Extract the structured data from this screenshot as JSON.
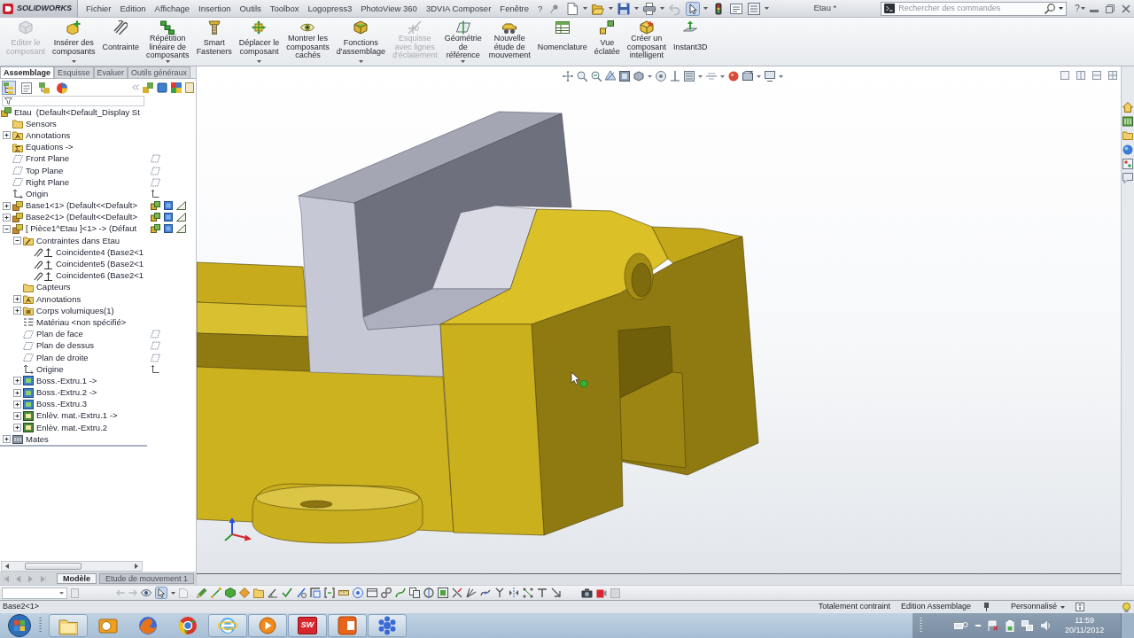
{
  "title_bar": {
    "logo": "SOLIDWORKS",
    "menu": [
      "Fichier",
      "Edition",
      "Affichage",
      "Insertion",
      "Outils",
      "Toolbox",
      "Logopress3",
      "PhotoView 360",
      "3DVIA Composer",
      "Fenêtre",
      "?"
    ],
    "quick_access": [
      {
        "kind": "new",
        "menu": true,
        "pressed": false
      },
      {
        "kind": "open",
        "menu": true,
        "pressed": false
      },
      {
        "kind": "save",
        "menu": true,
        "pressed": false
      },
      {
        "kind": "print",
        "menu": true,
        "pressed": false
      },
      {
        "kind": "undo",
        "menu": false,
        "pressed": false
      },
      {
        "kind": "select",
        "menu": true,
        "pressed": true
      },
      {
        "kind": "rebuild",
        "menu": false,
        "pressed": false
      },
      {
        "kind": "properties",
        "menu": false,
        "pressed": false
      },
      {
        "kind": "options",
        "menu": true,
        "pressed": false
      }
    ],
    "document_title": "Etau *",
    "search": {
      "placeholder": "Rechercher des commandes"
    },
    "help": "?"
  },
  "command_manager": {
    "buttons": [
      {
        "kind": "edit",
        "label": "Editer le\ncomposant",
        "disabled": true,
        "menu": false
      },
      {
        "kind": "insert",
        "label": "Insérer des\ncomposants",
        "disabled": false,
        "menu": true
      },
      {
        "kind": "mate",
        "label": "Contrainte",
        "disabled": false,
        "menu": false
      },
      {
        "kind": "pattern",
        "label": "Répétition\nlinéaire de\ncomposants",
        "disabled": false,
        "menu": true
      },
      {
        "kind": "fastener",
        "label": "Smart\nFasteners",
        "disabled": false,
        "menu": false
      },
      {
        "kind": "move",
        "label": "Déplacer le\ncomposant",
        "disabled": false,
        "menu": true
      },
      {
        "kind": "show",
        "label": "Montrer les\ncomposants\ncachés",
        "disabled": false,
        "menu": false
      },
      {
        "kind": "feature",
        "label": "Fonctions\nd'assemblage",
        "disabled": false,
        "menu": true
      },
      {
        "kind": "sketch",
        "label": "Esquisse\navec lignes\nd'éclatement",
        "disabled": true,
        "menu": false
      },
      {
        "kind": "geometry",
        "label": "Géométrie\nde\nréférence",
        "disabled": false,
        "menu": true
      },
      {
        "kind": "motion",
        "label": "Nouvelle\nétude de\nmouvement",
        "disabled": false,
        "menu": false
      },
      {
        "kind": "bom",
        "label": "Nomenclature",
        "disabled": false,
        "menu": false
      },
      {
        "kind": "explode",
        "label": "Vue\néclatée",
        "disabled": false,
        "menu": false
      },
      {
        "kind": "smart",
        "label": "Créer un\ncomposant\nintelligent",
        "disabled": false,
        "menu": false
      },
      {
        "kind": "instant3d",
        "label": "Instant3D",
        "disabled": false,
        "menu": false
      }
    ],
    "tabs": [
      {
        "label": "Assemblage",
        "selected": true
      },
      {
        "label": "Esquisse",
        "selected": false
      },
      {
        "label": "Evaluer",
        "selected": false
      },
      {
        "label": "Outils généraux",
        "selected": false
      }
    ]
  },
  "feature_tree": {
    "panel_tabs": [
      {
        "kind": "tree",
        "selected": true
      },
      {
        "kind": "properties",
        "selected": false
      },
      {
        "kind": "configurations",
        "selected": false
      },
      {
        "kind": "display",
        "selected": false
      }
    ],
    "items": [
      {
        "label": "Etau  (Default<Default_Display St",
        "kind": "assembly",
        "children": [
          {
            "label": "Sensors",
            "kind": "folder"
          },
          {
            "label": "Annotations",
            "kind": "annotations",
            "expanded": false
          },
          {
            "label": "Equations ->",
            "kind": "equations"
          },
          {
            "label": "Front Plane",
            "kind": "plane"
          },
          {
            "label": "Top Plane",
            "kind": "plane"
          },
          {
            "label": "Right Plane",
            "kind": "plane"
          },
          {
            "label": "Origin",
            "kind": "origin"
          },
          {
            "label": "Base1<1> (Default<<Default>",
            "kind": "part",
            "expanded": false
          },
          {
            "label": "Base2<1> (Default<<Default>",
            "kind": "part",
            "expanded": false
          },
          {
            "label": "[ Pièce1^Etau ]<1> -> (Défaut",
            "kind": "part",
            "expanded": true,
            "children": [
              {
                "label": "Contraintes dans Etau",
                "kind": "mate_folder",
                "expanded": true,
                "children": [
                  {
                    "label": "Coincidente4 (Base2<1",
                    "kind": "mate"
                  },
                  {
                    "label": "Coincidente5 (Base2<1",
                    "kind": "mate"
                  },
                  {
                    "label": "Coincidente6 (Base2<1",
                    "kind": "mate"
                  }
                ]
              },
              {
                "label": "Capteurs",
                "kind": "folder"
              },
              {
                "label": "Annotations",
                "kind": "annotations",
                "expanded": false
              },
              {
                "label": "Corps volumiques(1)",
                "kind": "bodies",
                "expanded": false
              },
              {
                "label": "Matériau <non spécifié>",
                "kind": "material"
              },
              {
                "label": "Plan de face",
                "kind": "plane"
              },
              {
                "label": "Plan de dessus",
                "kind": "plane"
              },
              {
                "label": "Plan de droite",
                "kind": "plane"
              },
              {
                "label": "Origine",
                "kind": "origin"
              },
              {
                "label": "Boss.-Extru.1 ->",
                "kind": "boss",
                "expanded": false
              },
              {
                "label": "Boss.-Extru.2 ->",
                "kind": "boss",
                "expanded": false
              },
              {
                "label": "Boss.-Extru.3",
                "kind": "boss",
                "expanded": false
              },
              {
                "label": "Enlèv. mat.-Extru.1 ->",
                "kind": "cut",
                "expanded": false
              },
              {
                "label": "Enlèv. mat.-Extru.2",
                "kind": "cut",
                "expanded": false
              }
            ]
          },
          {
            "label": "Mates",
            "kind": "mates",
            "expanded": false
          }
        ]
      }
    ],
    "bottom_tabs": [
      {
        "label": "Modèle",
        "selected": true
      },
      {
        "label": "Etude de mouvement 1",
        "selected": false
      }
    ]
  },
  "status_bar": {
    "selection": "Base2<1>",
    "constraint": "Totalement contraint",
    "mode": "Edition Assemblage",
    "units": "Personnalisé"
  },
  "taskbar": {
    "apps": [
      {
        "kind": "folder",
        "running": true
      },
      {
        "kind": "mail",
        "running": false
      },
      {
        "kind": "fox",
        "running": false
      },
      {
        "kind": "ball",
        "running": false
      },
      {
        "kind": "globe",
        "running": true
      },
      {
        "kind": "play",
        "running": true
      },
      {
        "kind": "sw",
        "label": "SW",
        "running": true
      },
      {
        "kind": "slides",
        "running": true
      },
      {
        "kind": "snowflake",
        "running": true
      }
    ],
    "time": "11:59",
    "date": "20/11/2012"
  }
}
